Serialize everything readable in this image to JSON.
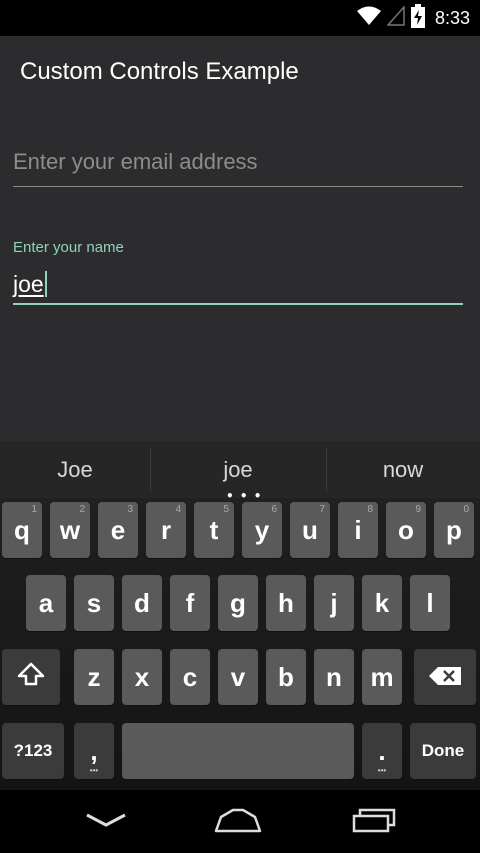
{
  "status": {
    "time": "8:33"
  },
  "app": {
    "title": "Custom Controls Example"
  },
  "form": {
    "email_placeholder": "Enter your email address",
    "name_label": "Enter your name",
    "name_value": "joe"
  },
  "keyboard": {
    "suggestions": [
      "Joe",
      "joe",
      "now"
    ],
    "row1": [
      {
        "k": "q",
        "h": "1"
      },
      {
        "k": "w",
        "h": "2"
      },
      {
        "k": "e",
        "h": "3"
      },
      {
        "k": "r",
        "h": "4"
      },
      {
        "k": "t",
        "h": "5"
      },
      {
        "k": "y",
        "h": "6"
      },
      {
        "k": "u",
        "h": "7"
      },
      {
        "k": "i",
        "h": "8"
      },
      {
        "k": "o",
        "h": "9"
      },
      {
        "k": "p",
        "h": "0"
      }
    ],
    "row2": [
      "a",
      "s",
      "d",
      "f",
      "g",
      "h",
      "j",
      "k",
      "l"
    ],
    "row3": [
      "z",
      "x",
      "c",
      "v",
      "b",
      "n",
      "m"
    ],
    "symbols_label": "?123",
    "comma_label": ",",
    "period_label": ".",
    "done_label": "Done"
  },
  "icons": {
    "wifi": "wifi-icon",
    "signal": "signal-icon",
    "battery": "battery-charging-icon",
    "shift": "shift-icon",
    "backspace": "backspace-icon",
    "back": "back-icon",
    "home": "home-icon",
    "recents": "recents-icon"
  },
  "colors": {
    "accent": "#8fd3bd",
    "background": "#2c2b2d",
    "key": "#5a5a5a"
  }
}
